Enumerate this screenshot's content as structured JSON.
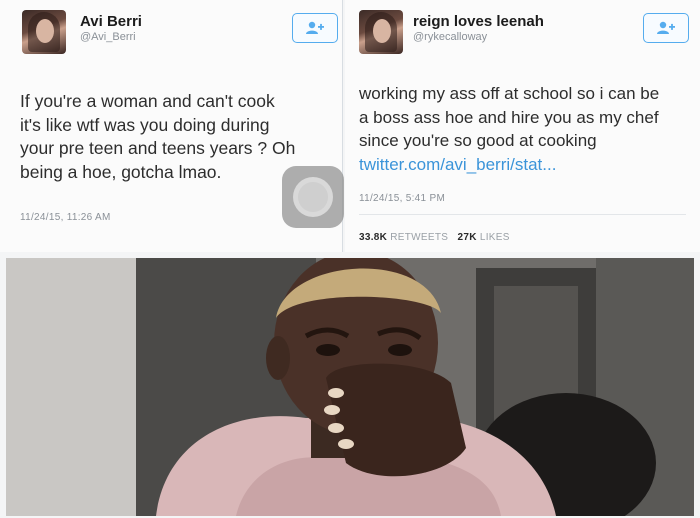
{
  "tweet_left": {
    "name": "Avi Berri",
    "handle": "@Avi_Berri",
    "text_lines": [
      "If you're a woman and can't cook",
      "it's like wtf was you doing during",
      "your pre teen and teens years ? Oh",
      "being a hoe, gotcha lmao."
    ],
    "timestamp": "11/24/15, 11:26 AM",
    "follow_icon": "follow-user-icon"
  },
  "tweet_right": {
    "name": "reign loves leenah",
    "handle": "@rykecalloway",
    "text_lines": [
      "working my ass off at school so i can be",
      "a boss ass hoe and hire you as my chef",
      "since you're so good at cooking"
    ],
    "link": "twitter.com/avi_berri/stat...",
    "timestamp": "11/24/15, 5:41 PM",
    "retweets_count": "33.8K",
    "retweets_label": "RETWEETS",
    "likes_count": "27K",
    "likes_label": "LIKES",
    "follow_icon": "follow-user-icon"
  },
  "colors": {
    "link": "#3b94d9",
    "follow_border": "#55acee",
    "muted_text": "#8a9097"
  },
  "photo": {
    "icon": "reaction-photo"
  }
}
